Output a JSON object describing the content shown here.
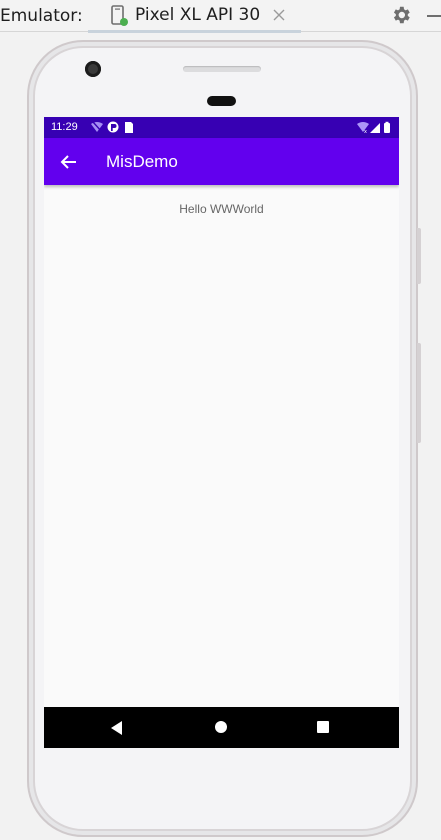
{
  "emulator": {
    "label": "Emulator:",
    "tab": {
      "title": "Pixel XL API 30",
      "icon": "device-icon",
      "close_icon": "close-icon"
    },
    "settings_icon": "gear-icon",
    "minimize_icon": "minus-icon"
  },
  "device": {
    "status_bar": {
      "time": "11:29",
      "left_icons": [
        "wifi-off-icon",
        "app-notification-icon",
        "sd-card-icon"
      ],
      "right_icons": [
        "wifi-icon",
        "cellular-icon",
        "battery-icon"
      ],
      "color": "#3700b3"
    },
    "app_bar": {
      "title": "MisDemo",
      "back_icon": "back-arrow-icon",
      "color": "#6200ee"
    },
    "content": {
      "message": "Hello WWWorld"
    },
    "nav_bar": {
      "buttons": [
        "back-triangle-icon",
        "home-circle-icon",
        "recents-square-icon"
      ]
    }
  }
}
